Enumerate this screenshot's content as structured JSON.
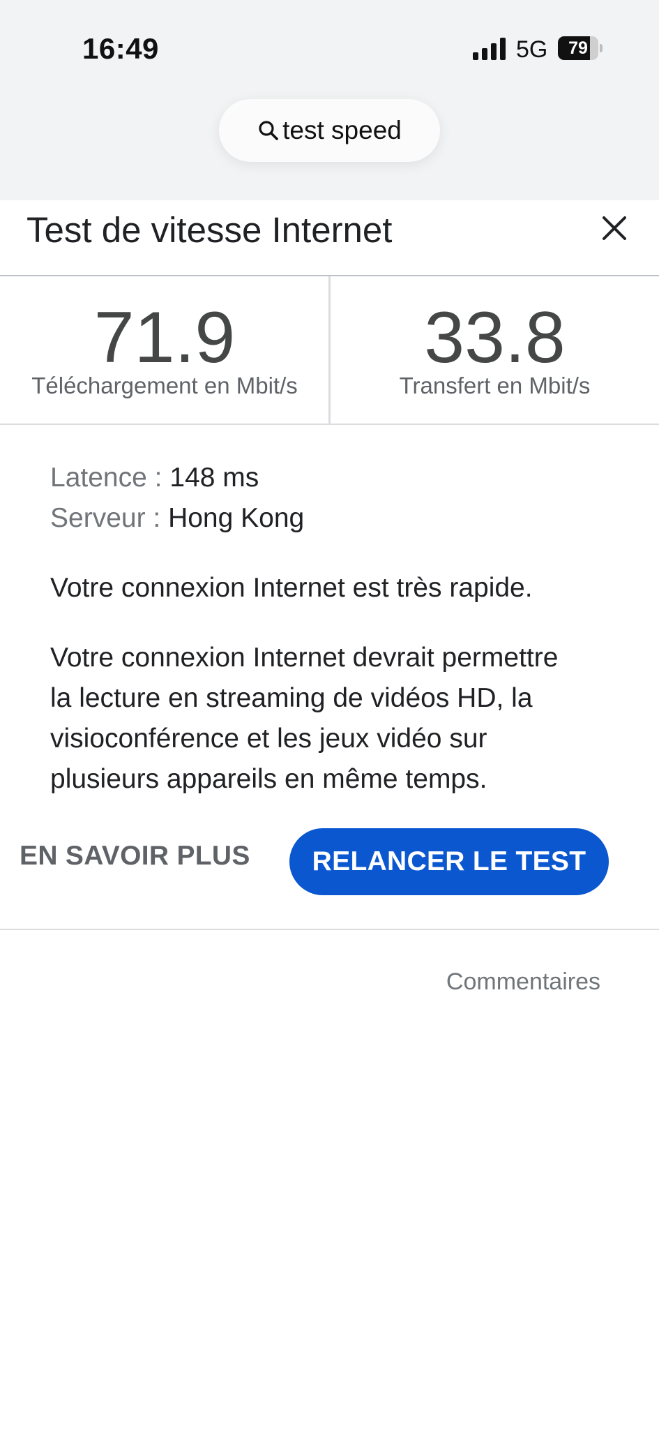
{
  "status_bar": {
    "time": "16:49",
    "network": "5G",
    "battery_level": "79",
    "battery_fraction": 0.79,
    "signal_icon": "cellular-signal-icon"
  },
  "search": {
    "query": "test speed",
    "icon": "search-icon"
  },
  "header": {
    "title": "Test de vitesse Internet",
    "close_icon": "close-icon"
  },
  "results": {
    "download_value": "71.9",
    "download_label": "Téléchargement en Mbit/s",
    "upload_value": "33.8",
    "upload_label": "Transfert en Mbit/s"
  },
  "details": {
    "latency_key": "Latence :",
    "latency_value": "148 ms",
    "server_key": "Serveur :",
    "server_value": "Hong Kong",
    "summary": "Votre connexion Internet est très rapide.",
    "description_lines": [
      "Votre connexion Internet devrait permettre",
      "la lecture en streaming de vidéos HD, la",
      "visioconférence et les jeux vidéo sur",
      "plusieurs appareils en même temps."
    ]
  },
  "actions": {
    "learn_more": "EN SAVOIR PLUS",
    "rerun": "RELANCER LE TEST"
  },
  "footer": {
    "feedback": "Commentaires"
  },
  "colors": {
    "accent": "#0b57d0",
    "top_background": "#f1f3f4",
    "text_primary": "#202124",
    "text_secondary": "#5f6368"
  }
}
